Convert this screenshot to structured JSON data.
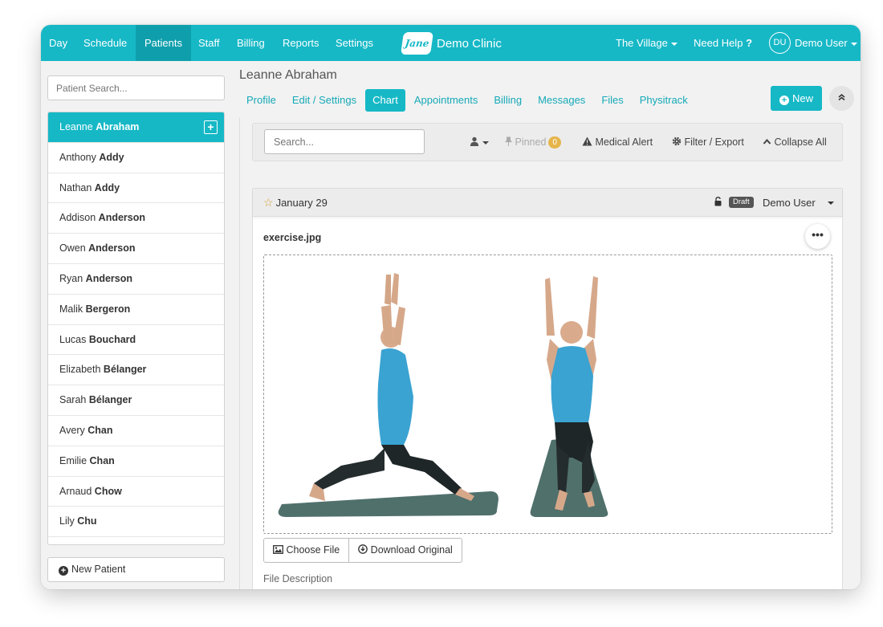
{
  "nav": {
    "items": [
      "Day",
      "Schedule",
      "Patients",
      "Staff",
      "Billing",
      "Reports",
      "Settings"
    ],
    "active_index": 2,
    "clinic_name": "Demo Clinic",
    "logo_text": "Jane",
    "location": "The Village",
    "help": "Need Help",
    "help_mark": "?",
    "user_initials": "DU",
    "user_name": "Demo User",
    "accent_color": "#16b8c6"
  },
  "sidebar": {
    "search_placeholder": "Patient Search...",
    "patients": [
      {
        "first": "Leanne",
        "last": "Abraham"
      },
      {
        "first": "Anthony",
        "last": "Addy"
      },
      {
        "first": "Nathan",
        "last": "Addy"
      },
      {
        "first": "Addison",
        "last": "Anderson"
      },
      {
        "first": "Owen",
        "last": "Anderson"
      },
      {
        "first": "Ryan",
        "last": "Anderson"
      },
      {
        "first": "Malik",
        "last": "Bergeron"
      },
      {
        "first": "Lucas",
        "last": "Bouchard"
      },
      {
        "first": "Elizabeth",
        "last": "Bélanger"
      },
      {
        "first": "Sarah",
        "last": "Bélanger"
      },
      {
        "first": "Avery",
        "last": "Chan"
      },
      {
        "first": "Emilie",
        "last": "Chan"
      },
      {
        "first": "Arnaud",
        "last": "Chow"
      },
      {
        "first": "Lily",
        "last": "Chu"
      }
    ],
    "selected_index": 0,
    "new_patient_label": "New Patient"
  },
  "patient": {
    "name": "Leanne Abraham",
    "tabs": [
      "Profile",
      "Edit / Settings",
      "Chart",
      "Appointments",
      "Billing",
      "Messages",
      "Files",
      "Physitrack"
    ],
    "active_tab_index": 2,
    "new_button": "New"
  },
  "chart_toolbar": {
    "search_placeholder": "Search...",
    "pinned_label": "Pinned",
    "pinned_count": "0",
    "medical_alert": "Medical Alert",
    "filter_export": "Filter / Export",
    "collapse_all": "Collapse All"
  },
  "entry": {
    "date": "January 29",
    "status": "Draft",
    "author": "Demo User",
    "file_name": "exercise.jpg",
    "choose_file": "Choose File",
    "download_original": "Download Original",
    "file_description": "File Description"
  }
}
